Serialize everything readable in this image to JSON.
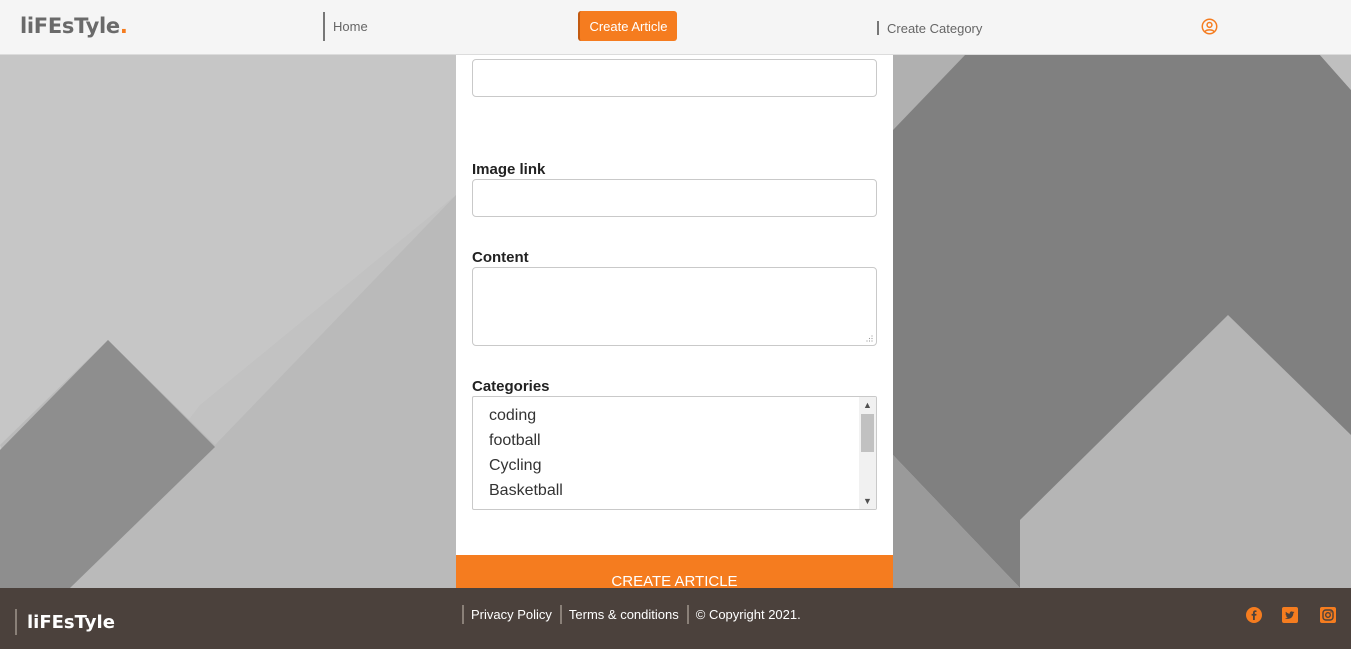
{
  "header": {
    "logo_text": "liFEsTyle",
    "logo_dot": ".",
    "nav": {
      "home": "Home",
      "create_article": "Create Article",
      "create_category": "Create Category"
    },
    "user_icon": "user-circle-icon"
  },
  "form": {
    "image_link_label": "Image link",
    "content_label": "Content",
    "categories_label": "Categories",
    "categories_options": [
      "coding",
      "football",
      "Cycling",
      "Basketball"
    ],
    "submit_label": "CREATE ARTICLE"
  },
  "footer": {
    "logo_text": "liFEsTyle",
    "links": [
      "Privacy Policy",
      "Terms & conditions"
    ],
    "copyright": "© Copyright 2021.",
    "social_icons": [
      "facebook-icon",
      "twitter-icon",
      "instagram-icon"
    ]
  },
  "colors": {
    "accent": "#f57c1f",
    "footer_bg": "#4b413c",
    "header_bg": "#f5f5f5"
  }
}
